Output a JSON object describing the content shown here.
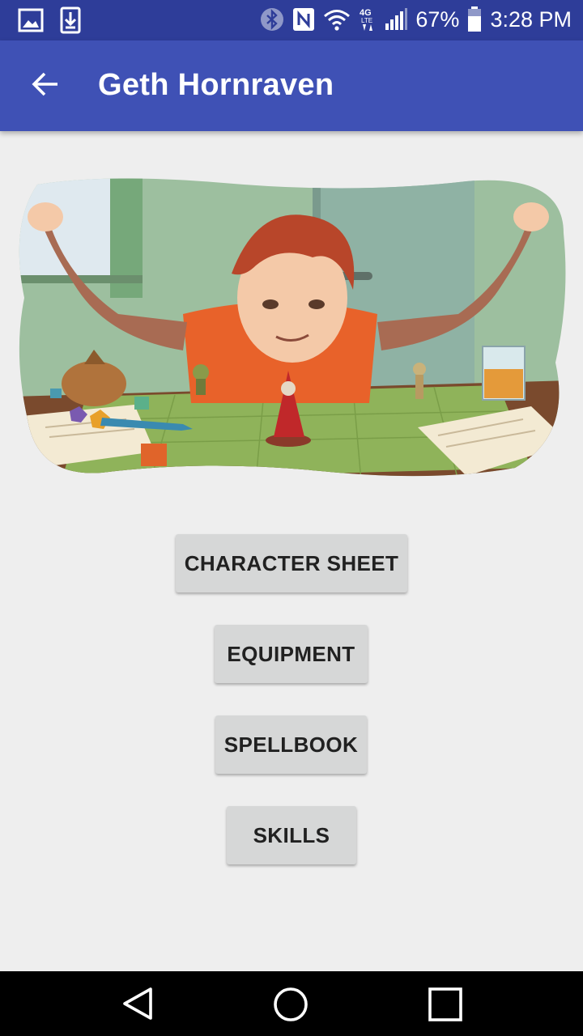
{
  "status_bar": {
    "battery_percent": "67%",
    "time": "3:28 PM",
    "network_label": "4G LTE",
    "icons": [
      "gallery-icon",
      "download-icon",
      "bluetooth-icon",
      "nfc-icon",
      "wifi-icon",
      "mobile-data-icon",
      "signal-icon",
      "battery-icon"
    ]
  },
  "app_bar": {
    "title": "Geth Hornraven",
    "back_icon": "arrow-back-icon",
    "color": "#3f51b5"
  },
  "hero_image": {
    "description_icon": "tabletop-game-illustration"
  },
  "menu": {
    "character_sheet": "CHARACTER SHEET",
    "equipment": "EQUIPMENT",
    "spellbook": "SPELLBOOK",
    "skills": "SKILLS"
  },
  "nav_bar": {
    "icons": [
      "back-triangle-icon",
      "home-circle-icon",
      "recents-square-icon"
    ]
  }
}
